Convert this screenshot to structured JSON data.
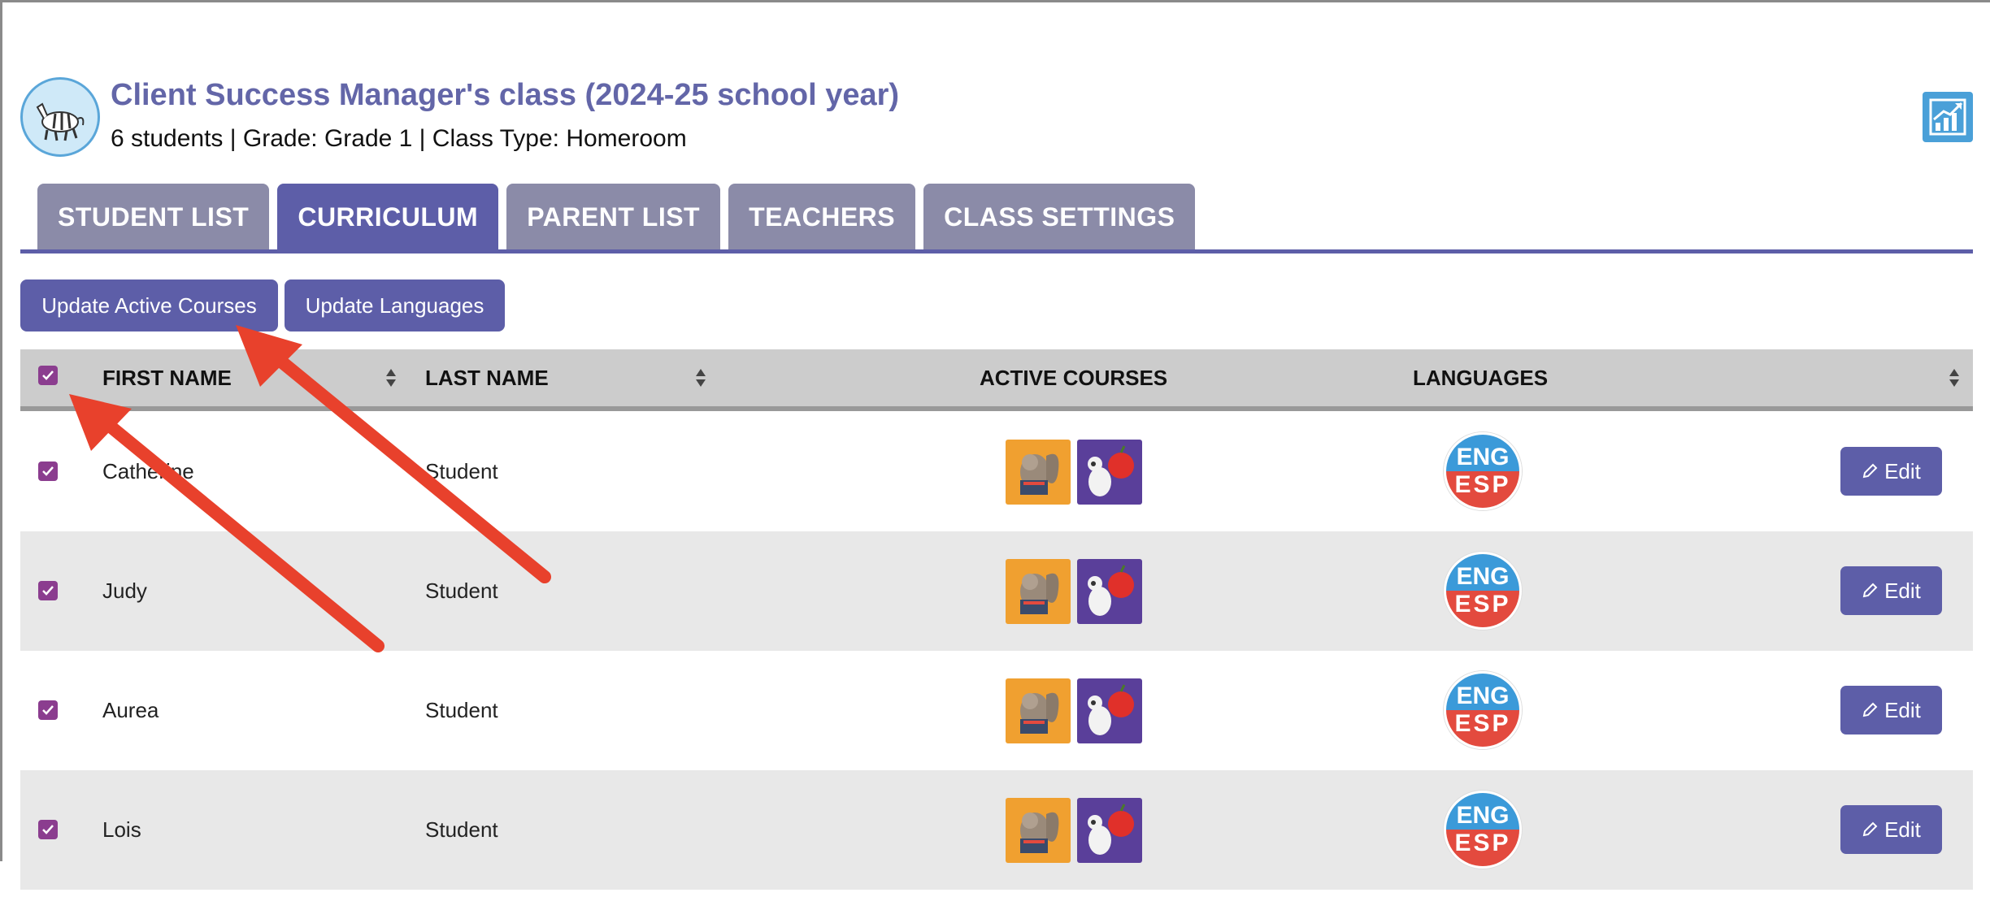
{
  "header": {
    "class_title": "Client Success Manager's class (2024-25 school year)",
    "class_meta": "6 students | Grade: Grade 1 | Class Type: Homeroom",
    "avatar_icon": "zebra-icon",
    "stats_icon": "growth-chart-icon"
  },
  "tabs": [
    {
      "label": "STUDENT LIST",
      "active": false
    },
    {
      "label": "CURRICULUM",
      "active": true
    },
    {
      "label": "PARENT LIST",
      "active": false
    },
    {
      "label": "TEACHERS",
      "active": false
    },
    {
      "label": "CLASS SETTINGS",
      "active": false
    }
  ],
  "actions": {
    "update_courses": "Update Active Courses",
    "update_languages": "Update Languages"
  },
  "table": {
    "headers": {
      "first_name": "FIRST NAME",
      "last_name": "LAST NAME",
      "active_courses": "ACTIVE COURSES",
      "languages": "LANGUAGES"
    },
    "rows": [
      {
        "first": "Catherine",
        "last": "Student",
        "checked": true,
        "lang_top": "ENG",
        "lang_bottom": "ESP",
        "edit": "Edit"
      },
      {
        "first": "Judy",
        "last": "Student",
        "checked": true,
        "lang_top": "ENG",
        "lang_bottom": "ESP",
        "edit": "Edit"
      },
      {
        "first": "Aurea",
        "last": "Student",
        "checked": true,
        "lang_top": "ENG",
        "lang_bottom": "ESP",
        "edit": "Edit"
      },
      {
        "first": "Lois",
        "last": "Student",
        "checked": true,
        "lang_top": "ENG",
        "lang_bottom": "ESP",
        "edit": "Edit"
      }
    ],
    "course_icons": [
      "squirrel-reading-course-icon",
      "mouse-apple-course-icon"
    ]
  },
  "colors": {
    "accent": "#5d5ea8",
    "tab_inactive": "#8b8ba8",
    "checkbox": "#8b3d8f",
    "annotation_arrow": "#e8412c"
  }
}
